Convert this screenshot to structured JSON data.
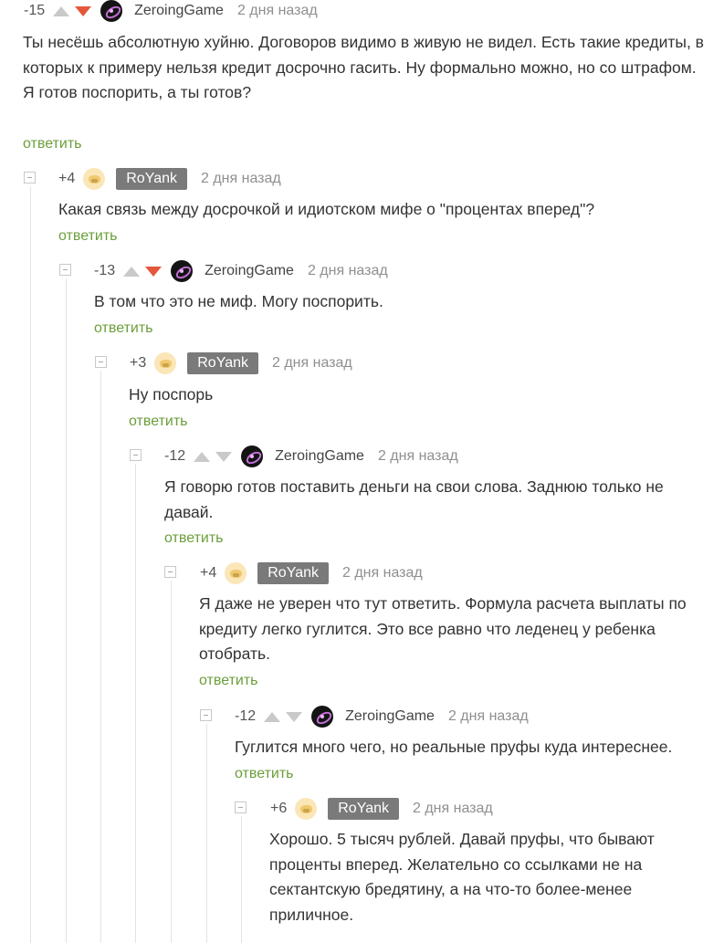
{
  "reply_label": "ответить",
  "colors": {
    "reply": "#6b9e3a",
    "downvote_active": "#e4573b",
    "badge": "#7a7a7a"
  },
  "comments": [
    {
      "rating": "-15",
      "author": "ZeroingGame",
      "avatar_icon": "zeroing-avatar",
      "author_style": "plain",
      "downvoted": true,
      "date": "2 дня назад",
      "paragraphs": [
        "Ты несёшь абсолютную хуйню. Договоров видимо в живую не видел. Есть такие кредиты, в которых к примеру нельзя кредит досрочно гасить. Ну формально можно, но со штрафом.",
        "Я готов поспорить, а ты готов?"
      ]
    },
    {
      "rating": "+4",
      "author": "RoYank",
      "avatar_icon": "royank-avatar",
      "author_style": "badge",
      "date": "2 дня назад",
      "paragraphs": [
        "Какая связь между досрочкой и идиотском мифе о \"процентах вперед\"?"
      ]
    },
    {
      "rating": "-13",
      "author": "ZeroingGame",
      "avatar_icon": "zeroing-avatar",
      "author_style": "plain",
      "downvoted": true,
      "date": "2 дня назад",
      "paragraphs": [
        "В том что это не миф. Могу поспорить."
      ]
    },
    {
      "rating": "+3",
      "author": "RoYank",
      "avatar_icon": "royank-avatar",
      "author_style": "badge",
      "date": "2 дня назад",
      "paragraphs": [
        "Ну поспорь"
      ]
    },
    {
      "rating": "-12",
      "author": "ZeroingGame",
      "avatar_icon": "zeroing-avatar",
      "author_style": "plain",
      "downvoted": false,
      "date": "2 дня назад",
      "paragraphs": [
        "Я говорю готов поставить деньги на свои слова. Заднюю только не давай."
      ]
    },
    {
      "rating": "+4",
      "author": "RoYank",
      "avatar_icon": "royank-avatar",
      "author_style": "badge",
      "date": "2 дня назад",
      "paragraphs": [
        "Я даже не уверен что тут ответить. Формула расчета выплаты по кредиту легко гуглится. Это все равно что леденец у ребенка отобрать."
      ]
    },
    {
      "rating": "-12",
      "author": "ZeroingGame",
      "avatar_icon": "zeroing-avatar",
      "author_style": "plain",
      "downvoted": false,
      "date": "2 дня назад",
      "paragraphs": [
        "Гуглится много чего, но реальные пруфы куда интереснее."
      ]
    },
    {
      "rating": "+6",
      "author": "RoYank",
      "avatar_icon": "royank-avatar",
      "author_style": "badge",
      "date": "2 дня назад",
      "paragraphs": [
        "Хорошо. 5 тысяч рублей. Давай пруфы, что бывают проценты вперед. Желательно со ссылками не на сектантскую бредятину, а на что-то более-менее приличное."
      ]
    }
  ]
}
